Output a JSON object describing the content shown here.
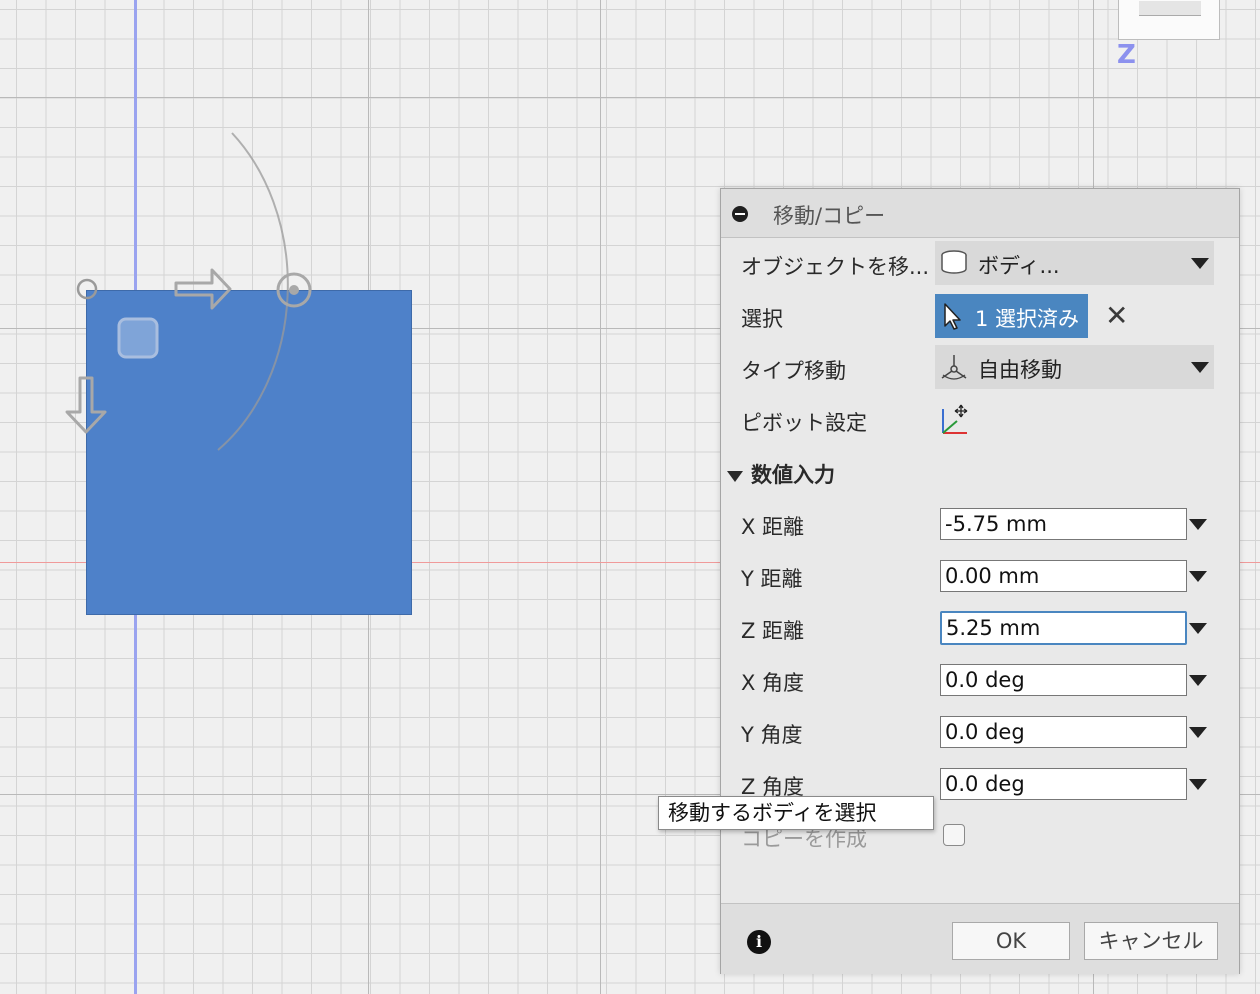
{
  "viewcube": {
    "z_label": "Z"
  },
  "dialog": {
    "title": "移動/コピー",
    "object_label": "オブジェクトを移...",
    "object_value": "ボディ...",
    "select_label": "選択",
    "select_value": "1 選択済み",
    "type_label": "タイプ移動",
    "type_value": "自由移動",
    "pivot_label": "ピボット設定",
    "section_title": "数値入力",
    "fields": [
      {
        "label": "X 距離",
        "value": "-5.75 mm"
      },
      {
        "label": "Y 距離",
        "value": "0.00 mm"
      },
      {
        "label": "Z 距離",
        "value": "5.25 mm"
      },
      {
        "label": "X 角度",
        "value": "0.0 deg"
      },
      {
        "label": "Y 角度",
        "value": "0.0 deg"
      },
      {
        "label": "Z 角度",
        "value": "0.0 deg"
      }
    ],
    "copy_label": "コピーを作成",
    "ok_label": "OK",
    "cancel_label": "キャンセル"
  },
  "tooltip": "移動するボディを選択",
  "colors": {
    "body_fill": "#4e81c9",
    "selection_blue": "#4a86c0",
    "axis_blue": "#9aa3ef",
    "axis_red": "#f09a9a"
  }
}
